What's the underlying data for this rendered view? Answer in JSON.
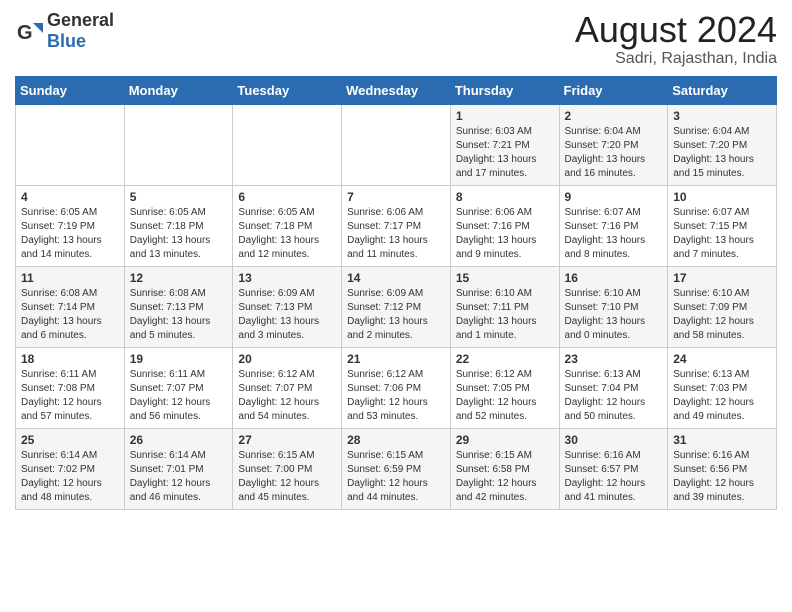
{
  "header": {
    "logo_general": "General",
    "logo_blue": "Blue",
    "month_year": "August 2024",
    "location": "Sadri, Rajasthan, India"
  },
  "weekdays": [
    "Sunday",
    "Monday",
    "Tuesday",
    "Wednesday",
    "Thursday",
    "Friday",
    "Saturday"
  ],
  "weeks": [
    [
      {
        "day": "",
        "info": ""
      },
      {
        "day": "",
        "info": ""
      },
      {
        "day": "",
        "info": ""
      },
      {
        "day": "",
        "info": ""
      },
      {
        "day": "1",
        "info": "Sunrise: 6:03 AM\nSunset: 7:21 PM\nDaylight: 13 hours\nand 17 minutes."
      },
      {
        "day": "2",
        "info": "Sunrise: 6:04 AM\nSunset: 7:20 PM\nDaylight: 13 hours\nand 16 minutes."
      },
      {
        "day": "3",
        "info": "Sunrise: 6:04 AM\nSunset: 7:20 PM\nDaylight: 13 hours\nand 15 minutes."
      }
    ],
    [
      {
        "day": "4",
        "info": "Sunrise: 6:05 AM\nSunset: 7:19 PM\nDaylight: 13 hours\nand 14 minutes."
      },
      {
        "day": "5",
        "info": "Sunrise: 6:05 AM\nSunset: 7:18 PM\nDaylight: 13 hours\nand 13 minutes."
      },
      {
        "day": "6",
        "info": "Sunrise: 6:05 AM\nSunset: 7:18 PM\nDaylight: 13 hours\nand 12 minutes."
      },
      {
        "day": "7",
        "info": "Sunrise: 6:06 AM\nSunset: 7:17 PM\nDaylight: 13 hours\nand 11 minutes."
      },
      {
        "day": "8",
        "info": "Sunrise: 6:06 AM\nSunset: 7:16 PM\nDaylight: 13 hours\nand 9 minutes."
      },
      {
        "day": "9",
        "info": "Sunrise: 6:07 AM\nSunset: 7:16 PM\nDaylight: 13 hours\nand 8 minutes."
      },
      {
        "day": "10",
        "info": "Sunrise: 6:07 AM\nSunset: 7:15 PM\nDaylight: 13 hours\nand 7 minutes."
      }
    ],
    [
      {
        "day": "11",
        "info": "Sunrise: 6:08 AM\nSunset: 7:14 PM\nDaylight: 13 hours\nand 6 minutes."
      },
      {
        "day": "12",
        "info": "Sunrise: 6:08 AM\nSunset: 7:13 PM\nDaylight: 13 hours\nand 5 minutes."
      },
      {
        "day": "13",
        "info": "Sunrise: 6:09 AM\nSunset: 7:13 PM\nDaylight: 13 hours\nand 3 minutes."
      },
      {
        "day": "14",
        "info": "Sunrise: 6:09 AM\nSunset: 7:12 PM\nDaylight: 13 hours\nand 2 minutes."
      },
      {
        "day": "15",
        "info": "Sunrise: 6:10 AM\nSunset: 7:11 PM\nDaylight: 13 hours\nand 1 minute."
      },
      {
        "day": "16",
        "info": "Sunrise: 6:10 AM\nSunset: 7:10 PM\nDaylight: 13 hours\nand 0 minutes."
      },
      {
        "day": "17",
        "info": "Sunrise: 6:10 AM\nSunset: 7:09 PM\nDaylight: 12 hours\nand 58 minutes."
      }
    ],
    [
      {
        "day": "18",
        "info": "Sunrise: 6:11 AM\nSunset: 7:08 PM\nDaylight: 12 hours\nand 57 minutes."
      },
      {
        "day": "19",
        "info": "Sunrise: 6:11 AM\nSunset: 7:07 PM\nDaylight: 12 hours\nand 56 minutes."
      },
      {
        "day": "20",
        "info": "Sunrise: 6:12 AM\nSunset: 7:07 PM\nDaylight: 12 hours\nand 54 minutes."
      },
      {
        "day": "21",
        "info": "Sunrise: 6:12 AM\nSunset: 7:06 PM\nDaylight: 12 hours\nand 53 minutes."
      },
      {
        "day": "22",
        "info": "Sunrise: 6:12 AM\nSunset: 7:05 PM\nDaylight: 12 hours\nand 52 minutes."
      },
      {
        "day": "23",
        "info": "Sunrise: 6:13 AM\nSunset: 7:04 PM\nDaylight: 12 hours\nand 50 minutes."
      },
      {
        "day": "24",
        "info": "Sunrise: 6:13 AM\nSunset: 7:03 PM\nDaylight: 12 hours\nand 49 minutes."
      }
    ],
    [
      {
        "day": "25",
        "info": "Sunrise: 6:14 AM\nSunset: 7:02 PM\nDaylight: 12 hours\nand 48 minutes."
      },
      {
        "day": "26",
        "info": "Sunrise: 6:14 AM\nSunset: 7:01 PM\nDaylight: 12 hours\nand 46 minutes."
      },
      {
        "day": "27",
        "info": "Sunrise: 6:15 AM\nSunset: 7:00 PM\nDaylight: 12 hours\nand 45 minutes."
      },
      {
        "day": "28",
        "info": "Sunrise: 6:15 AM\nSunset: 6:59 PM\nDaylight: 12 hours\nand 44 minutes."
      },
      {
        "day": "29",
        "info": "Sunrise: 6:15 AM\nSunset: 6:58 PM\nDaylight: 12 hours\nand 42 minutes."
      },
      {
        "day": "30",
        "info": "Sunrise: 6:16 AM\nSunset: 6:57 PM\nDaylight: 12 hours\nand 41 minutes."
      },
      {
        "day": "31",
        "info": "Sunrise: 6:16 AM\nSunset: 6:56 PM\nDaylight: 12 hours\nand 39 minutes."
      }
    ]
  ]
}
